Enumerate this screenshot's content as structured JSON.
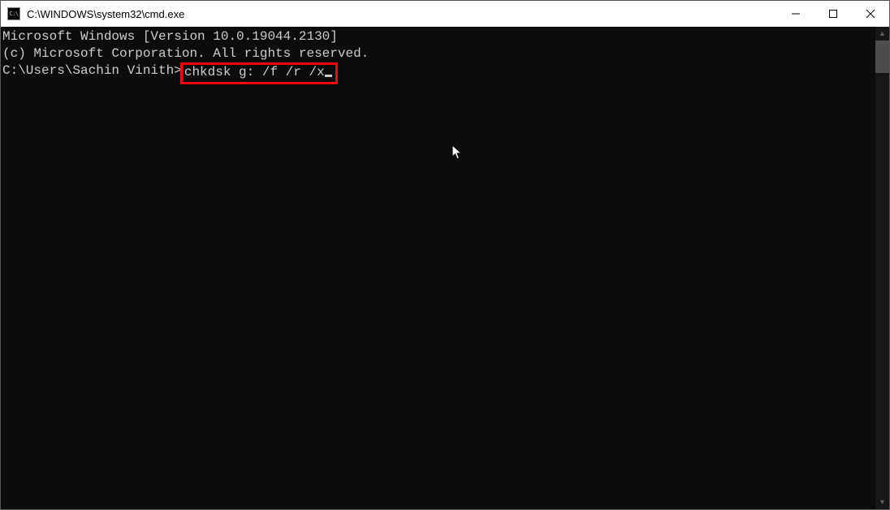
{
  "window": {
    "title": "C:\\WINDOWS\\system32\\cmd.exe",
    "icon_label": "C:\\"
  },
  "terminal": {
    "line1": "Microsoft Windows [Version 10.0.19044.2130]",
    "line2": "(c) Microsoft Corporation. All rights reserved.",
    "blank": "",
    "prompt": "C:\\Users\\Sachin Vinith>",
    "command": "chkdsk g: /f /r /x"
  },
  "scrollbar": {
    "up": "▲",
    "down": "▼"
  }
}
